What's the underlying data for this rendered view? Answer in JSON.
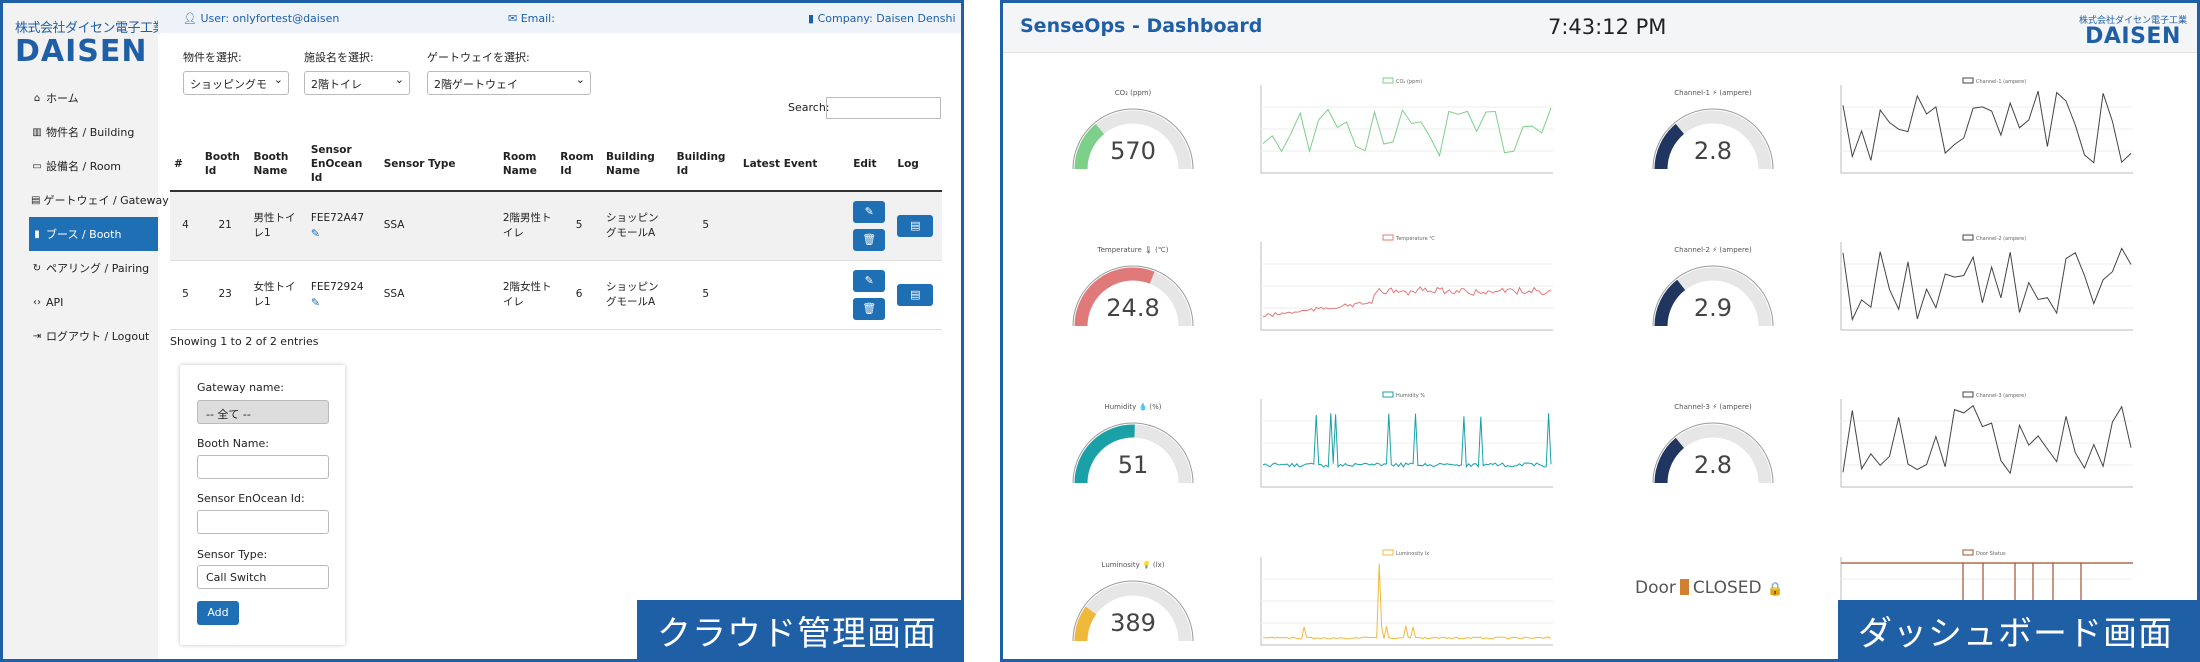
{
  "left": {
    "logo": {
      "small": "株式会社ダイセン電子工業",
      "big": "DAISEN"
    },
    "topbar": {
      "user": "User: onlyfortest@daisen",
      "email": "Email:",
      "company": "Company: Daisen Denshi"
    },
    "nav": [
      {
        "label": "ホーム",
        "icon": "home-icon",
        "glyph": "⌂"
      },
      {
        "label": "物件名 / Building",
        "icon": "building-icon",
        "glyph": "▥"
      },
      {
        "label": "設備名 / Room",
        "icon": "room-icon",
        "glyph": "▭"
      },
      {
        "label": "ゲートウェイ / Gateway",
        "icon": "gateway-icon",
        "glyph": "▤"
      },
      {
        "label": "ブース / Booth",
        "icon": "booth-icon",
        "glyph": "▮"
      },
      {
        "label": "ペアリング / Pairing",
        "icon": "pairing-icon",
        "glyph": "↻"
      },
      {
        "label": "API",
        "icon": "code-icon",
        "glyph": "‹›"
      },
      {
        "label": "ログアウト / Logout",
        "icon": "logout-icon",
        "glyph": "⇥"
      }
    ],
    "filters": {
      "property_label": "物件を選択:",
      "property_value": "ショッピングモ",
      "floor_label": "施設名を選択:",
      "floor_value": "2階トイレ",
      "gateway_label": "ゲートウェイを選択:",
      "gateway_value": "2階ゲートウェイ"
    },
    "search_label": "Search:",
    "columns": [
      "#",
      "Booth Id",
      "Booth Name",
      "Sensor EnOcean Id",
      "Sensor Type",
      "Room Name",
      "Room Id",
      "Building Name",
      "Building Id",
      "Latest Event",
      "Edit",
      "Log"
    ],
    "rows": [
      {
        "no": "4",
        "booth_id": "21",
        "booth_name": "男性トイレ1",
        "sensor_id": "FEE72A47",
        "sensor_type": "SSA",
        "room_name": "2階男性トイレ",
        "room_id": "5",
        "building_name": "ショッピングモールA",
        "building_id": "5",
        "latest_event": ""
      },
      {
        "no": "5",
        "booth_id": "23",
        "booth_name": "女性トイレ1",
        "sensor_id": "FEE72924",
        "sensor_type": "SSA",
        "room_name": "2階女性トイレ",
        "room_id": "6",
        "building_name": "ショッピングモールA",
        "building_id": "5",
        "latest_event": ""
      }
    ],
    "showing": "Showing 1 to 2 of 2 entries",
    "form": {
      "gateway_label": "Gateway name:",
      "gateway_value": "-- 全て --",
      "booth_label": "Booth Name:",
      "sensor_label": "Sensor EnOcean Id:",
      "type_label": "Sensor Type:",
      "type_value": "Call Switch",
      "add": "Add"
    },
    "caption": "クラウド管理画面"
  },
  "right": {
    "title": "SenseOps - Dashboard",
    "clock": "7:43:12 PM",
    "logo": {
      "small": "株式会社ダイセン電子工業",
      "big": "DAISEN"
    },
    "gauges": [
      {
        "label": "CO₂ (ppm)",
        "value": "570",
        "fraction": 0.28,
        "color": "#7dd08a"
      },
      {
        "label": "Temperature 🌡 (℃)",
        "value": "24.8",
        "fraction": 0.62,
        "color": "#e07a7a"
      },
      {
        "label": "Humidity 💧 (%)",
        "value": "51",
        "fraction": 0.51,
        "color": "#1aa1a8"
      },
      {
        "label": "Luminosity 💡 (lx)",
        "value": "389",
        "fraction": 0.2,
        "color": "#f0b83a"
      },
      {
        "label": "Channel-1 ⚡ (ampere)",
        "value": "2.8",
        "fraction": 0.28,
        "color": "#203560"
      },
      {
        "label": "Channel-2 ⚡ (ampere)",
        "value": "2.9",
        "fraction": 0.29,
        "color": "#203560"
      },
      {
        "label": "Channel-3 ⚡ (ampere)",
        "value": "2.8",
        "fraction": 0.28,
        "color": "#203560"
      }
    ],
    "charts": [
      {
        "legend": "CO₂ (ppm)",
        "color": "#7dd08a",
        "kind": "line"
      },
      {
        "legend": "Temperature ℃",
        "color": "#e07a7a",
        "kind": "line"
      },
      {
        "legend": "Humidity %",
        "color": "#1aa1a8",
        "kind": "line"
      },
      {
        "legend": "Luminosity lx",
        "color": "#f0b83a",
        "kind": "line"
      },
      {
        "legend": "Channel-1 (ampere)",
        "color": "#444444",
        "kind": "line"
      },
      {
        "legend": "Channel-2 (ampere)",
        "color": "#444444",
        "kind": "line"
      },
      {
        "legend": "Channel-3 (ampere)",
        "color": "#444444",
        "kind": "line"
      },
      {
        "legend": "Door Status",
        "color": "#a0522d",
        "kind": "step"
      }
    ],
    "door": {
      "label": "Door",
      "status": "CLOSED",
      "lock": "🔒"
    },
    "caption": "ダッシュボード画面"
  }
}
